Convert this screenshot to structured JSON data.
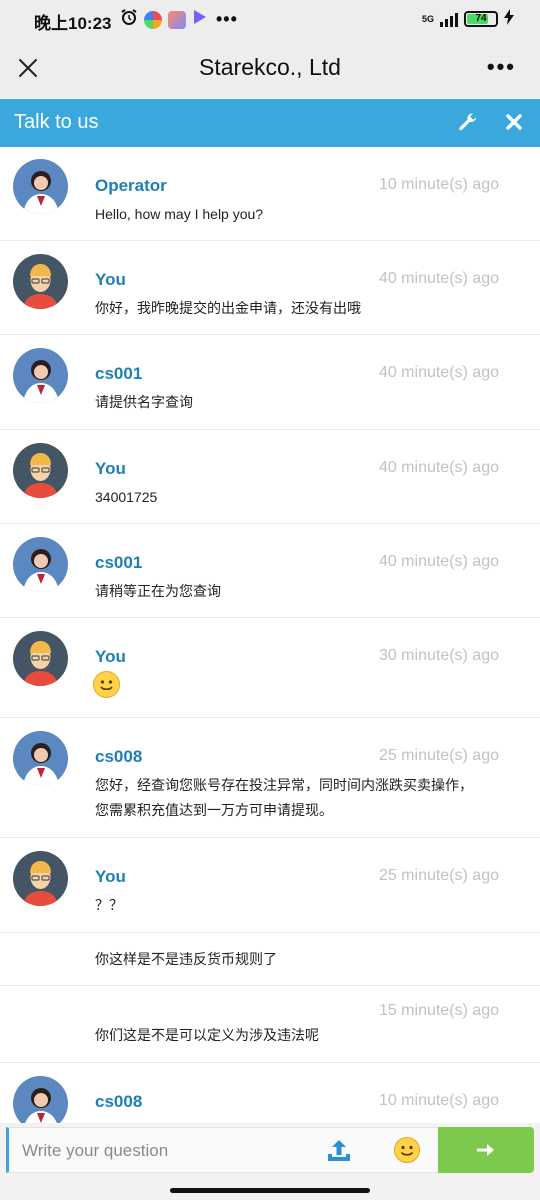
{
  "status_bar": {
    "time": "晚上10:23",
    "network": "5G",
    "battery": "74",
    "colors": {
      "app1": "#e84a5f",
      "app2": "#7a8cff",
      "app3": "#3b82f6"
    }
  },
  "title_bar": {
    "title": "Starekco., Ltd"
  },
  "chat_header": {
    "title": "Talk to us",
    "accent": "#3aa8dc"
  },
  "messages": [
    {
      "sender": "Operator",
      "time": "10 minute(s) ago",
      "text": "Hello, how may I help you?",
      "avatar": "operator-avatar"
    },
    {
      "sender": "You",
      "time": "40 minute(s) ago",
      "text": "你好，我昨晚提交的出金申请，还没有出哦",
      "avatar": "user-avatar"
    },
    {
      "sender": "cs001",
      "time": "40 minute(s) ago",
      "text": "请提供名字查询",
      "avatar": "operator-avatar"
    },
    {
      "sender": "You",
      "time": "40 minute(s) ago",
      "text": "34001725",
      "avatar": "user-avatar"
    },
    {
      "sender": "cs001",
      "time": "40 minute(s) ago",
      "text": "请稍等正在为您查询",
      "avatar": "operator-avatar"
    },
    {
      "sender": "You",
      "time": "30 minute(s) ago",
      "text": "",
      "avatar": "user-avatar",
      "emoji": "smile-emoji"
    },
    {
      "sender": "cs008",
      "time": "25 minute(s) ago",
      "text": "您好，经查询您账号存在投注异常，同时间内涨跌买卖操作，",
      "text2": "您需累积充值达到一万方可申请提现。",
      "avatar": "operator-avatar"
    },
    {
      "sender": "You",
      "time": "25 minute(s) ago",
      "text": "？？",
      "avatar": "user-avatar"
    },
    {
      "sender": "",
      "time": "",
      "text": "你这样是不是违反货币规则了"
    },
    {
      "sender": "",
      "time": "15 minute(s) ago",
      "text": "你们这是不是可以定义为涉及违法呢"
    },
    {
      "sender": "cs008",
      "time": "10 minute(s) ago",
      "text": "",
      "avatar": "operator-avatar"
    }
  ],
  "input": {
    "placeholder": "Write your question",
    "send_color": "#7cc94e"
  }
}
